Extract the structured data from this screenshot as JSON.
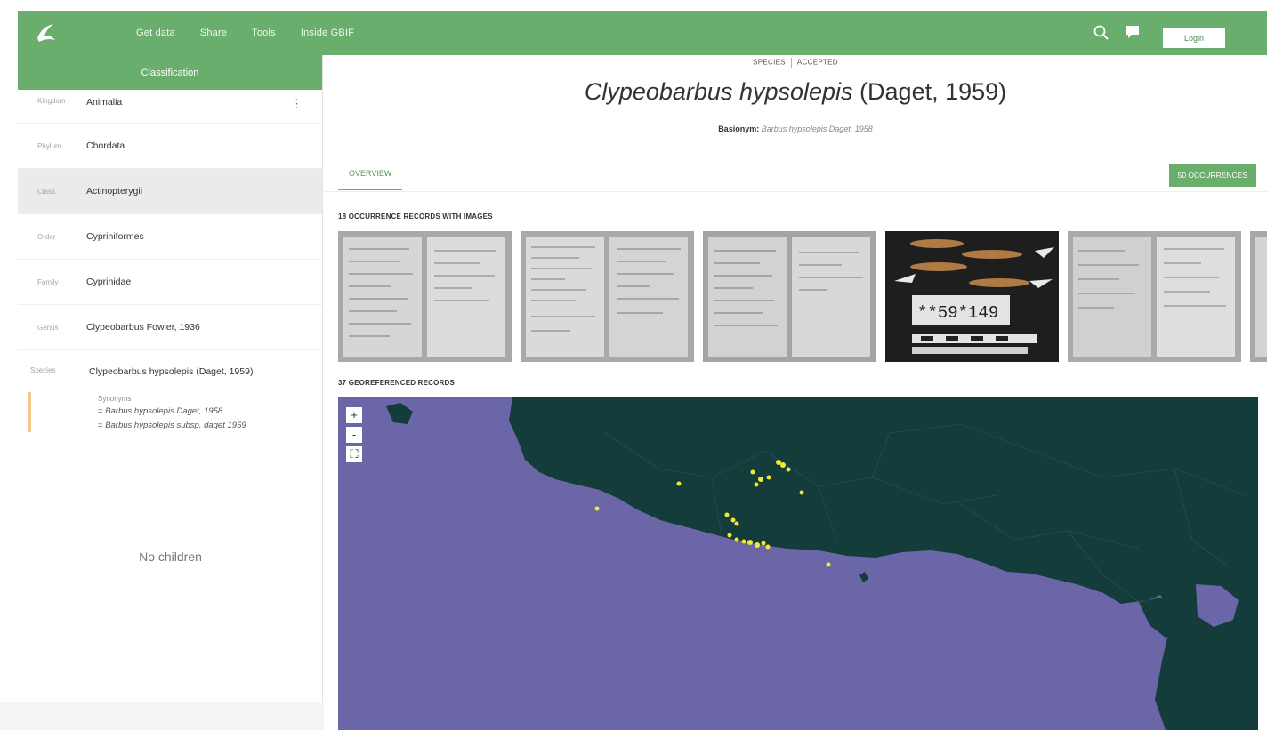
{
  "nav": {
    "items": [
      "Get data",
      "Share",
      "Tools",
      "Inside GBIF"
    ],
    "login_label": "Login"
  },
  "sidebar": {
    "header": "Classification",
    "ranks": [
      {
        "rank": "Kingdom",
        "name": "Animalia"
      },
      {
        "rank": "Phylum",
        "name": "Chordata"
      },
      {
        "rank": "Class",
        "name": "Actinopterygii"
      },
      {
        "rank": "Order",
        "name": "Cypriniformes"
      },
      {
        "rank": "Family",
        "name": "Cyprinidae"
      },
      {
        "rank": "Genus",
        "name": "Clypeobarbus Fowler, 1936"
      }
    ],
    "species_rank": "Species",
    "species_name": "Clypeobarbus hypsolepis (Daget, 1959)",
    "synonyms_title": "Synonyms",
    "synonyms": [
      "Barbus hypsolepis Daget, 1958",
      "Barbus hypsolepis subsp. daget 1959"
    ],
    "no_children": "No children"
  },
  "species": {
    "status_rank": "SPECIES",
    "status_accepted": "ACCEPTED",
    "name_italic": "Clypeobarbus hypsolepis",
    "authorship": "(Daget, 1959)",
    "basionym_label": "Basionym:",
    "basionym_value": "Barbus hypsolepis Daget, 1958"
  },
  "tabs": {
    "overview": "OVERVIEW",
    "occurrences_button": "50 OCCURRENCES"
  },
  "images": {
    "heading": "18 OCCURRENCE RECORDS WITH IMAGES",
    "specimen_label": "**59*149"
  },
  "map": {
    "heading": "37 GEOREFERENCED RECORDS",
    "zoom_in": "+",
    "zoom_out": "-",
    "fullscreen": "⛶",
    "colors": {
      "water": "#6b66a8",
      "land": "#133c3a",
      "point": "#f4e836"
    }
  },
  "colors": {
    "brand": "#6aae6d",
    "accent": "#e5a84d"
  }
}
